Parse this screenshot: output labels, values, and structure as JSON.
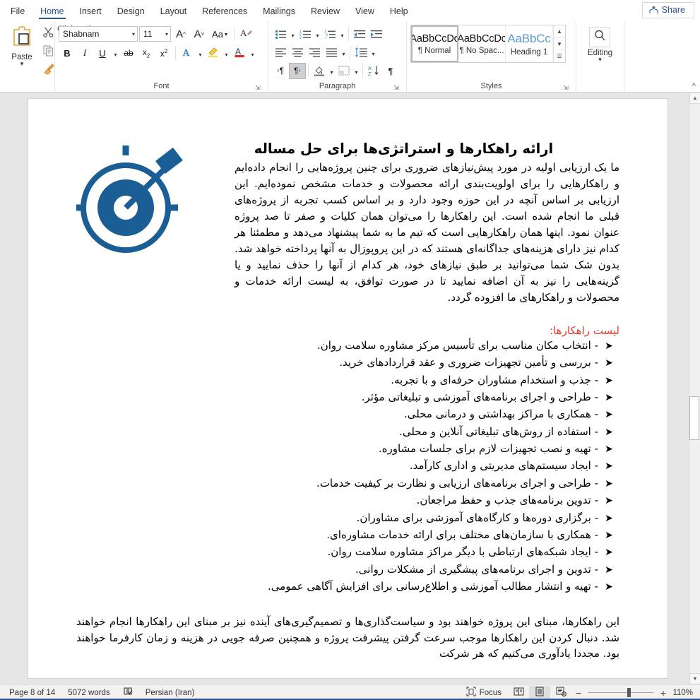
{
  "window": {
    "share_label": "Share"
  },
  "tabs": [
    {
      "label": "File",
      "active": false
    },
    {
      "label": "Home",
      "active": true
    },
    {
      "label": "Insert",
      "active": false
    },
    {
      "label": "Design",
      "active": false
    },
    {
      "label": "Layout",
      "active": false
    },
    {
      "label": "References",
      "active": false
    },
    {
      "label": "Mailings",
      "active": false
    },
    {
      "label": "Review",
      "active": false
    },
    {
      "label": "View",
      "active": false
    },
    {
      "label": "Help",
      "active": false
    }
  ],
  "ribbon": {
    "clipboard": {
      "label": "Clipboard",
      "paste_label": "Paste",
      "cut_icon": "scissors-icon",
      "copy_icon": "copy-icon",
      "format_painter_icon": "format-painter-icon"
    },
    "font": {
      "label": "Font",
      "font_name": "Shabnam",
      "font_size": "11",
      "grow_font": "A",
      "shrink_font": "A",
      "change_case": "Aa",
      "clear_formatting_icon": "clear-formatting-icon",
      "bold": "B",
      "italic": "I",
      "underline": "U",
      "strikethrough": "ab",
      "subscript": "x",
      "superscript": "x",
      "text_effects": "A",
      "highlight": "A",
      "font_color": "A"
    },
    "paragraph": {
      "label": "Paragraph",
      "bullets_icon": "bullets-icon",
      "numbering_icon": "numbering-icon",
      "multilevel_icon": "multilevel-list-icon",
      "decrease_indent_icon": "decrease-indent-icon",
      "increase_indent_icon": "increase-indent-icon",
      "align_left_icon": "align-left-icon",
      "align_center_icon": "align-center-icon",
      "align_right_icon": "align-right-icon",
      "justify_icon": "justify-icon",
      "line_spacing_icon": "line-spacing-icon",
      "ltr_label": "¶",
      "rtl_label": "¶",
      "shading_icon": "shading-icon",
      "borders_icon": "borders-icon",
      "sort_icon": "sort-icon",
      "show_marks": "¶"
    },
    "styles": {
      "label": "Styles",
      "items": [
        {
          "preview": "AaBbCcDc",
          "name": "¶ Normal",
          "selected": true,
          "blue": false
        },
        {
          "preview": "AaBbCcDc",
          "name": "¶ No Spac...",
          "selected": false,
          "blue": false
        },
        {
          "preview": "AaBbCc",
          "name": "Heading 1",
          "selected": false,
          "blue": true
        }
      ]
    },
    "editing": {
      "label": "Editing",
      "button_label": "Editing",
      "icon": "search-icon"
    }
  },
  "document": {
    "heading": "ارائه راهکارها و استراتژی‌ها برای حل مساله",
    "intro_paragraph": "ما یک ارزیابی اولیه در مورد پیش‌نیازهای ضروری برای چنین پروژه‌هایی را انجام داده‌ایم و راهکارهایی را برای اولویت‌بندی ارائه محصولات و خدمات مشخص نموده‌ایم. این ارزیابی بر اساس آنچه در این حوزه وجود دارد و بر اساس کسب تجربه از پروژه‌های قبلی ما انجام شده است. این راهکارها را می‌توان همان کلیات و صفر تا صد پروژه عنوان نمود. اینها همان راهکارهایی است که تیم ما به شما پیشنهاد می‌دهد و مطمئنا هر کدام نیز دارای هزینه‌های جداگانه‌ای هستند که در این پروپوزال به آنها پرداخته خواهد شد. بدون شک شما می‌توانید بر طبق نیازهای خود، هر کدام از آنها را حذف نمایید و یا گزینه‌هایی را نیز به آن اضافه نمایید تا در صورت توافق، به لیست ارائه خدمات و محصولات و راهکارهای ما افزوده گردد.",
    "list_heading": "لیست راهکارها:",
    "list_heading_color": "#e8392a",
    "bullet_glyph": "➤",
    "list_items": [
      "- انتخاب مکان مناسب برای تأسیس مرکز مشاوره سلامت روان.",
      "- بررسی و تأمین تجهیزات ضروری و عقد قراردادهای خرید.",
      "- جذب و استخدام مشاوران حرفه‌ای و با تجربه.",
      "- طراحی و اجرای برنامه‌های آموزشی و تبلیغاتی مؤثر.",
      "- همکاری با مراکز بهداشتی و درمانی محلی.",
      "- استفاده از روش‌های تبلیغاتی آنلاین و محلی.",
      "- تهیه و نصب تجهیزات لازم برای جلسات مشاوره.",
      "- ایجاد سیستم‌های مدیریتی و اداری کارآمد.",
      "- طراحی و اجرای برنامه‌های ارزیابی و نظارت بر کیفیت خدمات.",
      "- تدوین برنامه‌های جذب و حفظ مراجعان.",
      "- برگزاری دوره‌ها و کارگاه‌های آموزشی برای مشاوران.",
      "- همکاری با سازمان‌های مختلف برای ارائه خدمات مشاوره‌ای.",
      "- ایجاد شبکه‌های ارتباطی با دیگر مراکز مشاوره سلامت روان.",
      "- تدوین و اجرای برنامه‌های پیشگیری از مشکلات روانی.",
      "- تهیه و انتشار مطالب آموزشی و اطلاع‌رسانی برای افزایش آگاهی عمومی."
    ],
    "closing_paragraph": "این راهکارها، مبنای این پروژه خواهند بود و سیاست‌گذاری‌ها و تصمیم‌گیری‌های آینده نیز بر مبنای این راهکارها انجام خواهند شد. دنبال کردن این راهکارها موجب سرعت گرفتن پیشرفت پروژه و همچنین صرفه جویی در هزینه و زمان کارفرما خواهند بود. مجددا یادآوری می‌کنیم که هر شرکت",
    "image_icon": "target-dartboard-icon",
    "image_color": "#1b5e96"
  },
  "status_bar": {
    "page_info": "Page 8 of 14",
    "word_count": "5072 words",
    "proofing_icon": "proofing-errors-icon",
    "language": "Persian (Iran)",
    "focus_label": "Focus",
    "focus_icon": "focus-mode-icon",
    "read_mode_icon": "read-mode-icon",
    "print_layout_icon": "print-layout-icon",
    "web_layout_icon": "web-layout-icon",
    "zoom_out": "−",
    "zoom_in": "+",
    "zoom_level": "110%"
  }
}
